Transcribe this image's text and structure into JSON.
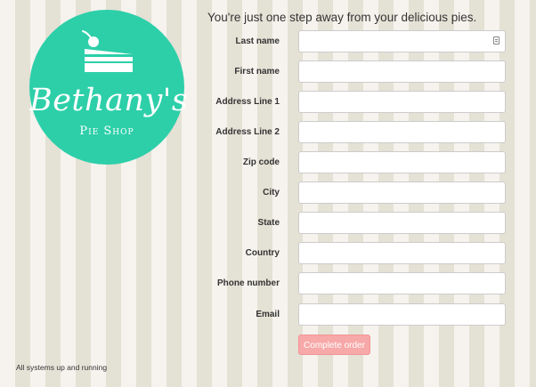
{
  "logo": {
    "script_text": "Bethany's",
    "subtitle_text": "Pie Shop",
    "background_color": "#2dcfa9",
    "icon": "cake-slice-icon"
  },
  "heading": "You're just one step away from your delicious pies.",
  "form": {
    "fields": [
      {
        "label": "Last name",
        "value": ""
      },
      {
        "label": "First name",
        "value": ""
      },
      {
        "label": "Address Line 1",
        "value": ""
      },
      {
        "label": "Address Line 2",
        "value": ""
      },
      {
        "label": "Zip code",
        "value": ""
      },
      {
        "label": "City",
        "value": ""
      },
      {
        "label": "State",
        "value": ""
      },
      {
        "label": "Country",
        "value": ""
      },
      {
        "label": "Phone number",
        "value": ""
      },
      {
        "label": "Email",
        "value": ""
      }
    ],
    "submit_label": "Complete order",
    "submit_color": "#f7a8a8"
  },
  "footer": {
    "status": "All systems up and running"
  },
  "colors": {
    "stripe_light": "#f6f3ee",
    "stripe_dark": "#e4e1d5"
  }
}
